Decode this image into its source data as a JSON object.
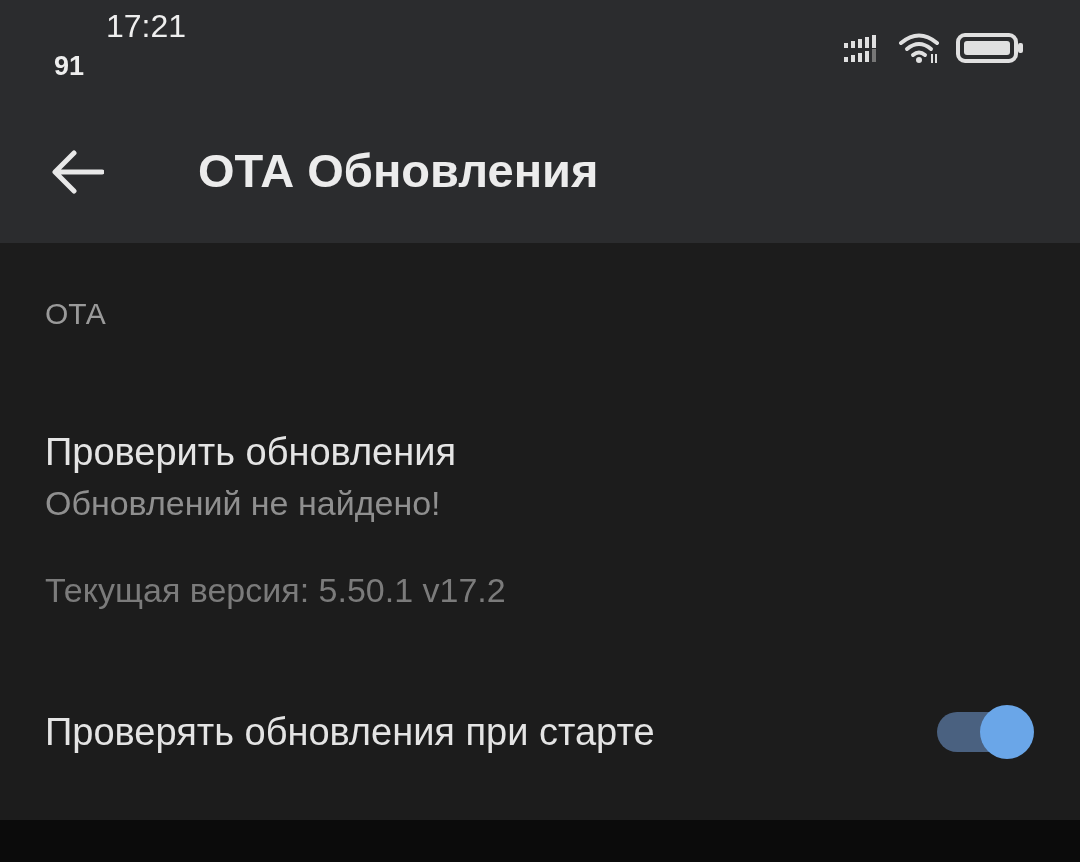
{
  "status_bar": {
    "time": "17:21",
    "indicator": "91"
  },
  "app_bar": {
    "title": "ОТА Обновления"
  },
  "section": {
    "header": "ОТА"
  },
  "items": [
    {
      "kind": "preference",
      "title": "Проверить обновления",
      "summary": "Обновлений не найдено!"
    },
    {
      "kind": "info",
      "text": "Текущая версия: 5.50.1 v17.2"
    },
    {
      "kind": "switch",
      "title": "Проверять обновления при старте",
      "on": true
    }
  ]
}
